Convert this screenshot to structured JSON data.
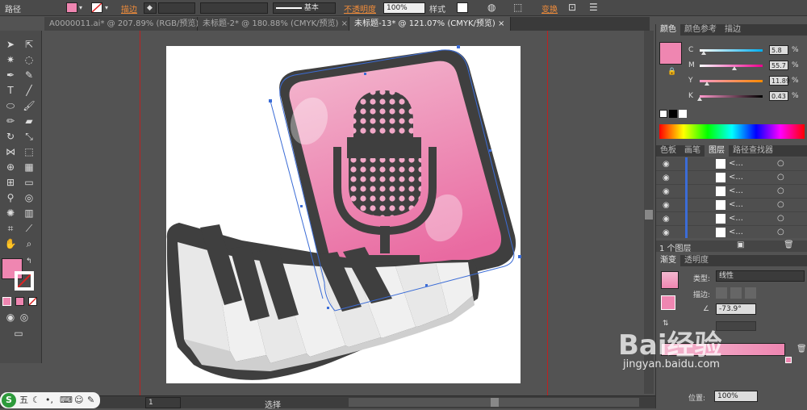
{
  "control_bar": {
    "path_label": "路径",
    "stroke_label": "描边",
    "stroke_style": "基本",
    "opacity_label": "不透明度",
    "opacity_value": "100%",
    "style_label": "样式",
    "transform_label": "变换"
  },
  "tabs": [
    {
      "label": "A0000011.ai* @ 207.89% (RGB/预览)"
    },
    {
      "label": "未标题-2* @ 180.88% (CMYK/预览)"
    },
    {
      "label": "未标题-13* @ 121.07% (CMYK/预览)"
    }
  ],
  "color_panel": {
    "tabs": [
      "颜色",
      "颜色参考",
      "描边"
    ],
    "channels": [
      {
        "name": "C",
        "value": "5.8",
        "unit": "%",
        "fraction": 0.058
      },
      {
        "name": "M",
        "value": "55.7",
        "unit": "%",
        "fraction": 0.557
      },
      {
        "name": "Y",
        "value": "11.89",
        "unit": "%",
        "fraction": 0.1189
      },
      {
        "name": "K",
        "value": "0.43",
        "unit": "%",
        "fraction": 0.0043
      }
    ],
    "fill_color": "#ef86b1"
  },
  "layers_panel": {
    "tabs": [
      "色板",
      "画笔",
      "图层",
      "路径查找器"
    ],
    "rows": [
      "<...",
      "<...",
      "<...",
      "<...",
      "<...",
      "<..."
    ],
    "footer": "1 个图层"
  },
  "gradient_panel": {
    "tabs": [
      "渐变",
      "透明度"
    ],
    "type_label": "类型:",
    "type_value": "线性",
    "stroke_label": "描边:",
    "angle_value": "-73.9°",
    "position_label": "位置:",
    "position_value": "100%"
  },
  "status_bar": {
    "zoom_value": "1",
    "mode": "选择"
  },
  "ime": {
    "brand": "S",
    "mode": "五"
  },
  "watermark": {
    "brand": "Bai经验",
    "url": "jingyan.baidu.com"
  },
  "colors": {
    "accent_pink": "#ef86b1",
    "pink_light": "#f3b8cf",
    "dark_gray": "#3f3f3f",
    "selection_blue": "#3b6cd6"
  }
}
